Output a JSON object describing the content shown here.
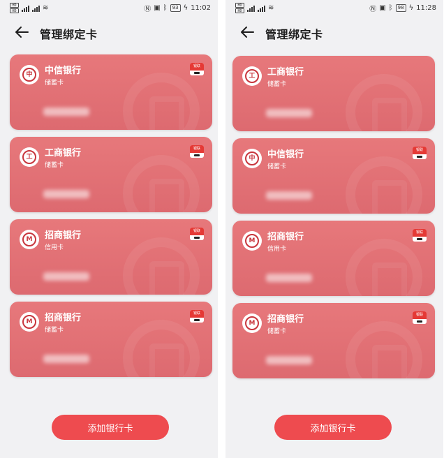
{
  "left": {
    "status": {
      "sim1": "HD",
      "sim2": "HD",
      "battery": "93",
      "time": "11:02"
    },
    "title": "管理绑定卡",
    "cards": [
      {
        "bank": "中信银行",
        "type": "储蓄卡",
        "logo": "中"
      },
      {
        "bank": "工商银行",
        "type": "储蓄卡",
        "logo": "工"
      },
      {
        "bank": "招商银行",
        "type": "信用卡",
        "logo": "M"
      },
      {
        "bank": "招商银行",
        "type": "储蓄卡",
        "logo": "M"
      }
    ],
    "add_button": "添加银行卡"
  },
  "right": {
    "status": {
      "sim1": "HD",
      "sim2": "HD",
      "battery": "98",
      "time": "11:28"
    },
    "title": "管理绑定卡",
    "cards": [
      {
        "bank": "工商银行",
        "type": "储蓄卡",
        "logo": "工"
      },
      {
        "bank": "中信银行",
        "type": "储蓄卡",
        "logo": "中"
      },
      {
        "bank": "招商银行",
        "type": "信用卡",
        "logo": "M"
      },
      {
        "bank": "招商银行",
        "type": "储蓄卡",
        "logo": "M"
      }
    ],
    "add_button": "添加银行卡"
  },
  "icons": {
    "back": "arrow-left-icon",
    "unionpay": "unionpay-icon",
    "wifi": "wifi-icon",
    "bluetooth": "bluetooth-icon",
    "nfc": "nfc-icon"
  },
  "colors": {
    "card": "#e2727a",
    "button": "#ee4b4f",
    "background": "#f1f1f3"
  }
}
